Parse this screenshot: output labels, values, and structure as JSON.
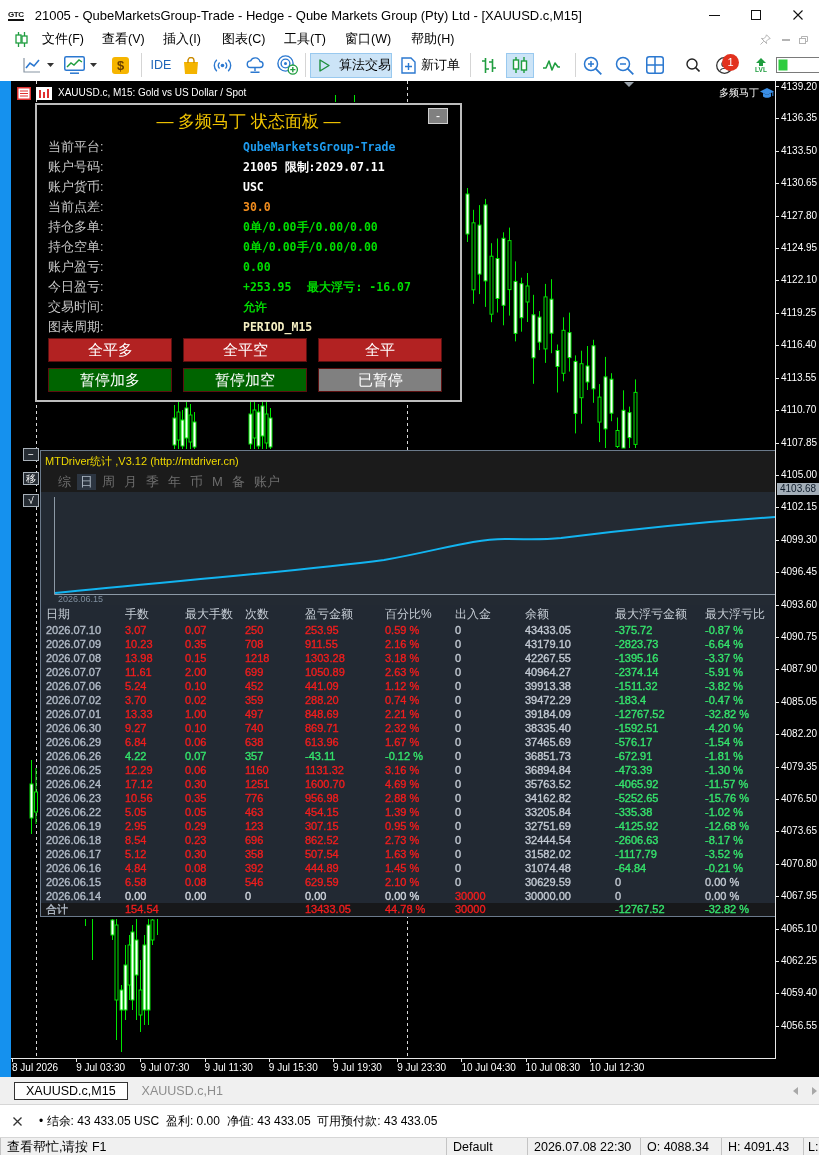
{
  "window": {
    "logo": "GTC",
    "title": "21005 - QubeMarketsGroup-Trade - Hedge - Qube Markets Group (Pty) Ltd - [XAUUSD.c,M15]"
  },
  "menu": [
    "文件(F)",
    "查看(V)",
    "插入(I)",
    "图表(C)",
    "工具(T)",
    "窗口(W)",
    "帮助(H)"
  ],
  "toolbar": {
    "wallet_symbol": "$",
    "ide": "IDE",
    "algo_trading": {
      "label": "算法交易",
      "on": true
    },
    "new_order": "新订单",
    "chart_types": [
      {
        "kind": "bars",
        "selected": false
      },
      {
        "kind": "candles",
        "selected": true
      },
      {
        "kind": "line",
        "selected": false
      }
    ],
    "notifications": "1",
    "lvl_label": "LVL"
  },
  "chart": {
    "title": "XAUUSD.c, M15:  Gold vs US Dollar / Spot",
    "expert": "多频马丁",
    "price_ticks": [
      "4139.20",
      "4136.35",
      "4133.50",
      "4130.65",
      "4127.80",
      "4124.95",
      "4122.10",
      "4119.25",
      "4116.40",
      "4113.55",
      "4110.70",
      "4107.85",
      "4105.00",
      "4102.15",
      "4099.30",
      "4096.45",
      "4093.60",
      "4090.75",
      "4087.90",
      "4085.05",
      "4082.20",
      "4079.35",
      "4076.50",
      "4073.65",
      "4070.80",
      "4067.95",
      "4065.10",
      "4062.25",
      "4059.40",
      "4056.55"
    ],
    "current_price": "4103.68",
    "time_ticks": [
      "8 Jul 2026",
      "9 Jul 03:30",
      "9 Jul 07:30",
      "9 Jul 11:30",
      "9 Jul 15:30",
      "9 Jul 19:30",
      "9 Jul 23:30",
      "10 Jul 04:30",
      "10 Jul 08:30",
      "10 Jul 12:30"
    ],
    "side_buttons": [
      "−",
      "移",
      "√"
    ]
  },
  "status_panel": {
    "title": "— 多频马丁 状态面板 —",
    "minimize": "-",
    "rows": [
      {
        "label": "当前平台:",
        "value": "QubeMarketsGroup-Trade",
        "color": "#1e9cf0"
      },
      {
        "label": "账户号码:",
        "value": "21005 限制:2029.07.11",
        "color": "#ffffff"
      },
      {
        "label": "账户货币:",
        "value": "USC",
        "color": "#ffffff"
      },
      {
        "label": "当前点差:",
        "value": "30.0",
        "color": "#f08c1e"
      },
      {
        "label": "持仓多单:",
        "value": "0单/0.00手/0.00/0.00",
        "color": "#00dd00"
      },
      {
        "label": "持仓空单:",
        "value": "0单/0.00手/0.00/0.00",
        "color": "#00dd00"
      },
      {
        "label": "账户盈亏:",
        "value": "0.00",
        "color": "#00dd00"
      },
      {
        "label": "今日盈亏:",
        "value": "+253.95",
        "extra": "最大浮亏: -16.07",
        "color": "#00dd00"
      },
      {
        "label": "交易时间:",
        "value": "允许",
        "color": "#00dd00"
      },
      {
        "label": "图表周期:",
        "value": "PERIOD_M15",
        "color": "#f5efc2"
      }
    ],
    "buttons": [
      {
        "label": "全平多",
        "color": "#b22222"
      },
      {
        "label": "全平空",
        "color": "#b22222"
      },
      {
        "label": "全平",
        "color": "#b22222"
      },
      {
        "label": "暂停加多",
        "color": "#006400"
      },
      {
        "label": "暂停加空",
        "color": "#006400"
      },
      {
        "label": "已暂停",
        "color": "#808080"
      }
    ]
  },
  "stats_panel": {
    "title": "MTDriver统计 ,V3.12 (http://mtdriver.cn)",
    "tabs": [
      {
        "label": "综",
        "selected": false
      },
      {
        "label": "日",
        "selected": true
      },
      {
        "label": "周",
        "selected": false
      },
      {
        "label": "月",
        "selected": false
      },
      {
        "label": "季",
        "selected": false
      },
      {
        "label": "年",
        "selected": false
      },
      {
        "label": "币",
        "selected": false
      },
      {
        "label": "M",
        "selected": false
      },
      {
        "label": "备",
        "selected": false
      },
      {
        "label": "账户",
        "selected": false
      }
    ],
    "chart_start": "2026.06.15",
    "columns": [
      "日期",
      "手数",
      "最大手数",
      "次数",
      "盈亏金额",
      "百分比%",
      "出入金",
      "余额",
      "最大浮亏金额",
      "最大浮亏比"
    ],
    "rows": [
      {
        "cells": [
          "2026.07.10",
          "3.07",
          "0.07",
          "250",
          "253.95",
          "0.59 %",
          "0",
          "43433.05",
          "-375.72",
          "-0.87 %"
        ],
        "color": "#f21d1d",
        "cash_highlight": false,
        "drawdown_highlight": true
      },
      {
        "cells": [
          "2026.07.09",
          "10.23",
          "0.35",
          "708",
          "911.55",
          "2.16 %",
          "0",
          "43179.10",
          "-2823.73",
          "-6.64 %"
        ],
        "color": "#f21d1d",
        "cash_highlight": false,
        "drawdown_highlight": true
      },
      {
        "cells": [
          "2026.07.08",
          "13.98",
          "0.15",
          "1218",
          "1303.28",
          "3.18 %",
          "0",
          "42267.55",
          "-1395.16",
          "-3.37 %"
        ],
        "color": "#f21d1d",
        "cash_highlight": false,
        "drawdown_highlight": true
      },
      {
        "cells": [
          "2026.07.07",
          "11.61",
          "2.00",
          "699",
          "1050.89",
          "2.63 %",
          "0",
          "40964.27",
          "-2374.14",
          "-5.91 %"
        ],
        "color": "#f21d1d",
        "cash_highlight": false,
        "drawdown_highlight": true
      },
      {
        "cells": [
          "2026.07.06",
          "5.24",
          "0.10",
          "452",
          "441.09",
          "1.12 %",
          "0",
          "39913.38",
          "-1511.32",
          "-3.82 %"
        ],
        "color": "#f21d1d",
        "cash_highlight": false,
        "drawdown_highlight": true
      },
      {
        "cells": [
          "2026.07.02",
          "3.70",
          "0.02",
          "359",
          "288.20",
          "0.74 %",
          "0",
          "39472.29",
          "-183.4",
          "-0.47 %"
        ],
        "color": "#f21d1d",
        "cash_highlight": false,
        "drawdown_highlight": true
      },
      {
        "cells": [
          "2026.07.01",
          "13.33",
          "1.00",
          "497",
          "848.69",
          "2.21 %",
          "0",
          "39184.09",
          "-12767.52",
          "-32.82 %"
        ],
        "color": "#f21d1d",
        "cash_highlight": false,
        "drawdown_highlight": true
      },
      {
        "cells": [
          "2026.06.30",
          "9.27",
          "0.10",
          "740",
          "869.71",
          "2.32 %",
          "0",
          "38335.40",
          "-1592.51",
          "-4.20 %"
        ],
        "color": "#f21d1d",
        "cash_highlight": false,
        "drawdown_highlight": true
      },
      {
        "cells": [
          "2026.06.29",
          "6.84",
          "0.06",
          "638",
          "613.96",
          "1.67 %",
          "0",
          "37465.69",
          "-576.17",
          "-1.54 %"
        ],
        "color": "#f21d1d",
        "cash_highlight": false,
        "drawdown_highlight": true
      },
      {
        "cells": [
          "2026.06.26",
          "4.22",
          "0.07",
          "357",
          "-43.11",
          "-0.12 %",
          "0",
          "36851.73",
          "-672.91",
          "-1.81 %"
        ],
        "color": "#35e46c",
        "cash_highlight": false,
        "drawdown_highlight": true
      },
      {
        "cells": [
          "2026.06.25",
          "12.29",
          "0.06",
          "1160",
          "1131.32",
          "3.16 %",
          "0",
          "36894.84",
          "-473.39",
          "-1.30 %"
        ],
        "color": "#f21d1d",
        "cash_highlight": false,
        "drawdown_highlight": true
      },
      {
        "cells": [
          "2026.06.24",
          "17.12",
          "0.30",
          "1251",
          "1600.70",
          "4.69 %",
          "0",
          "35763.52",
          "-4065.92",
          "-11.57 %"
        ],
        "color": "#f21d1d",
        "cash_highlight": false,
        "drawdown_highlight": true
      },
      {
        "cells": [
          "2026.06.23",
          "10.56",
          "0.35",
          "776",
          "956.98",
          "2.88 %",
          "0",
          "34162.82",
          "-5252.65",
          "-15.76 %"
        ],
        "color": "#f21d1d",
        "cash_highlight": false,
        "drawdown_highlight": true
      },
      {
        "cells": [
          "2026.06.22",
          "5.05",
          "0.05",
          "463",
          "454.15",
          "1.39 %",
          "0",
          "33205.84",
          "-335.38",
          "-1.02 %"
        ],
        "color": "#f21d1d",
        "cash_highlight": false,
        "drawdown_highlight": true
      },
      {
        "cells": [
          "2026.06.19",
          "2.95",
          "0.29",
          "123",
          "307.15",
          "0.95 %",
          "0",
          "32751.69",
          "-4125.92",
          "-12.68 %"
        ],
        "color": "#f21d1d",
        "cash_highlight": false,
        "drawdown_highlight": true
      },
      {
        "cells": [
          "2026.06.18",
          "8.54",
          "0.23",
          "696",
          "862.52",
          "2.73 %",
          "0",
          "32444.54",
          "-2606.63",
          "-8.17 %"
        ],
        "color": "#f21d1d",
        "cash_highlight": false,
        "drawdown_highlight": true
      },
      {
        "cells": [
          "2026.06.17",
          "5.12",
          "0.30",
          "358",
          "507.54",
          "1.63 %",
          "0",
          "31582.02",
          "-1117.79",
          "-3.52 %"
        ],
        "color": "#f21d1d",
        "cash_highlight": false,
        "drawdown_highlight": true
      },
      {
        "cells": [
          "2026.06.16",
          "4.84",
          "0.08",
          "392",
          "444.89",
          "1.45 %",
          "0",
          "31074.48",
          "-64.84",
          "-0.21 %"
        ],
        "color": "#f21d1d",
        "cash_highlight": false,
        "drawdown_highlight": true
      },
      {
        "cells": [
          "2026.06.15",
          "6.58",
          "0.08",
          "546",
          "629.59",
          "2.10 %",
          "0",
          "30629.59",
          "0",
          "0.00 %"
        ],
        "color": "#f21d1d",
        "cash_highlight": false,
        "drawdown_highlight": false
      },
      {
        "cells": [
          "2026.06.14",
          "0.00",
          "0.00",
          "0",
          "0.00",
          "0.00 %",
          "30000",
          "30000.00",
          "0",
          "0.00 %"
        ],
        "color": "#d0d6de",
        "cash_highlight": true,
        "drawdown_highlight": false
      }
    ],
    "total": {
      "label": "合计",
      "lots": "154.54",
      "pnl": "13433.05",
      "pct": "44.78 %",
      "cash": "30000",
      "max_dd": "-12767.52",
      "max_dd_pct": "-32.82 %",
      "color": "#f21d1d",
      "cash_highlight": true,
      "drawdown_highlight": true
    }
  },
  "chart_tabs": [
    {
      "label": "XAUUSD.c,M15",
      "selected": true
    },
    {
      "label": "XAUUSD.c,H1",
      "selected": false
    }
  ],
  "toolbox": {
    "summary": "• 结余: 43 433.05 USC  盈利: 0.00  净值: 43 433.05  可用预付款: 43 433.05"
  },
  "status_bar": [
    "查看帮忙,请按 F1",
    "Default",
    "2026.07.08 22:30",
    "O: 4088.34",
    "H: 4091.43",
    "L:"
  ]
}
